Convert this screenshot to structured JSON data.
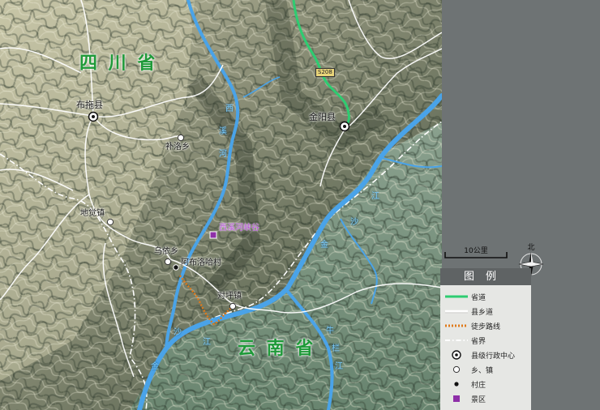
{
  "map": {
    "province_labels": {
      "sichuan": "四 川 省",
      "yunnan": "云 南 省"
    },
    "places": {
      "butuo": "布拖县",
      "jinyang": "金阳县",
      "buluo": "补洛乡",
      "dijue": "地觉镇",
      "wuyi": "乌依乡",
      "abuluoha": "阿布洛哈村",
      "duiping": "对坪镇",
      "xixihe": "西溪河峡谷"
    },
    "rivers": {
      "xixi": [
        "西",
        "溪",
        "河"
      ],
      "jinsha_right": [
        "金",
        "沙",
        "江"
      ],
      "jinsha_left": [
        "沙",
        "江",
        "金"
      ],
      "niulan": [
        "牛",
        "栏",
        "江"
      ]
    },
    "road_code": "S208"
  },
  "scalebar": {
    "label": "10公里"
  },
  "north": {
    "label": "北"
  },
  "legend": {
    "title": "图例",
    "items": [
      {
        "key": "provincial_road",
        "label": "省道",
        "color": "#2ecc71"
      },
      {
        "key": "county_road",
        "label": "县乡道",
        "color": "#ffffff"
      },
      {
        "key": "hiking",
        "label": "徒步路线",
        "color": "#e07a1a"
      },
      {
        "key": "province_border",
        "label": "省界",
        "color": "#ffffff"
      },
      {
        "key": "county_seat",
        "label": "县级行政中心",
        "color": "#000000"
      },
      {
        "key": "town",
        "label": "乡、镇",
        "color": "#ffffff"
      },
      {
        "key": "village",
        "label": "村庄",
        "color": "#000000"
      },
      {
        "key": "scenic",
        "label": "景区",
        "color": "#8e2fa8"
      }
    ]
  },
  "colors": {
    "river": "#4aa3e8",
    "terrain_light": "#b9b89a",
    "terrain_dark": "#3f4a3c",
    "terrain_yunnan": "#7f9a86",
    "panel": "#6e7374"
  }
}
